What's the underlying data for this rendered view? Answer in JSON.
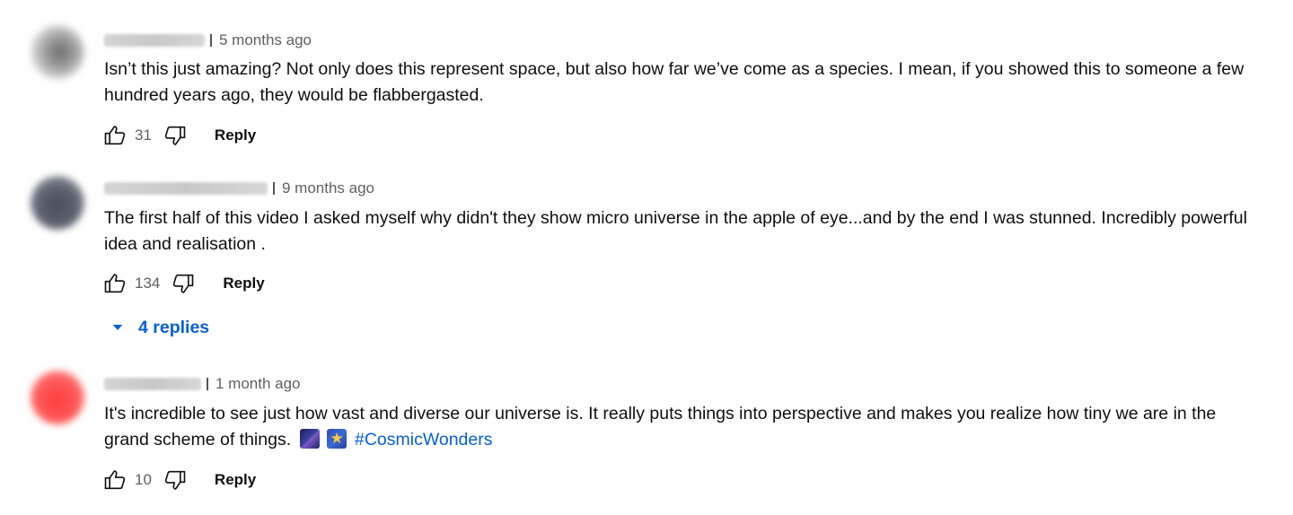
{
  "comments": [
    {
      "time": "5 months ago",
      "text": "Isn’t this just amazing? Not only does this represent space, but also how far we’ve come as a species. I mean, if you showed this to someone a few hundred years ago, they would be flabbergasted.",
      "likes": "31",
      "reply_label": "Reply"
    },
    {
      "time": "9 months ago",
      "text": "The first half of this video I asked myself why didn't they show micro universe in the apple of eye...and by the end I was stunned. Incredibly powerful idea and realisation .",
      "likes": "134",
      "reply_label": "Reply",
      "replies_label": "4 replies"
    },
    {
      "time": "1 month ago",
      "text": "It's incredible to see just how vast and diverse our universe is. It really puts things into perspective and makes you realize how tiny we are in the grand scheme of things.",
      "hashtag": "#CosmicWonders",
      "emojis": [
        "milky-way-emoji",
        "shooting-star-emoji"
      ],
      "likes": "10",
      "reply_label": "Reply"
    }
  ],
  "icons": {
    "like": "thumbs-up-icon",
    "dislike": "thumbs-down-icon",
    "expand": "caret-down-icon"
  },
  "colors": {
    "link": "#065fd4",
    "secondary_text": "#606060",
    "primary_text": "#0f0f0f"
  }
}
